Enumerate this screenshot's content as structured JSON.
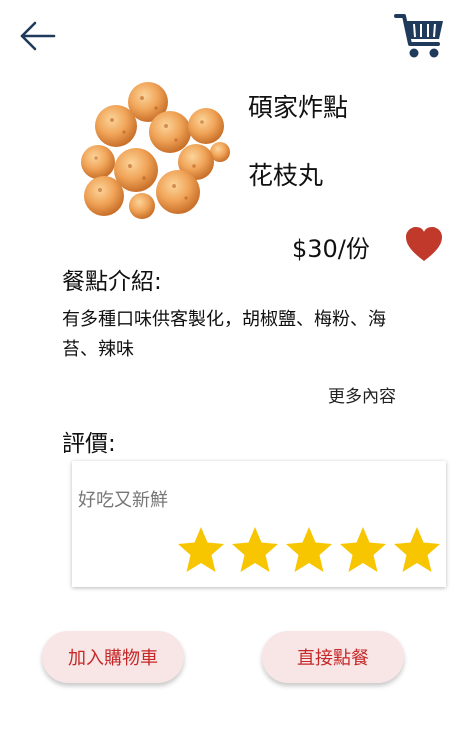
{
  "header": {
    "back_icon": "arrow-left-icon",
    "cart_icon": "shopping-cart-icon",
    "icon_color": "#1f3a5a"
  },
  "product": {
    "image": "fried-balls-food-image",
    "shop_name": "碩家炸點",
    "name": "花枝丸",
    "price": "$30/份",
    "favorite_icon": "heart-icon",
    "favorite_color": "#c0392b"
  },
  "intro": {
    "title": "餐點介紹:",
    "text": "有多種口味供客製化，胡椒鹽、梅粉、海苔、辣味",
    "more_label": "更多內容"
  },
  "reviews": {
    "title": "評價:",
    "items": [
      {
        "text": "好吃又新鮮",
        "rating": 5,
        "max_rating": 5
      }
    ],
    "star_color": "#f7c600"
  },
  "actions": {
    "add_to_cart_label": "加入購物車",
    "order_now_label": "直接點餐",
    "button_bg": "#f8e6e6",
    "button_text_color": "#c62828"
  }
}
